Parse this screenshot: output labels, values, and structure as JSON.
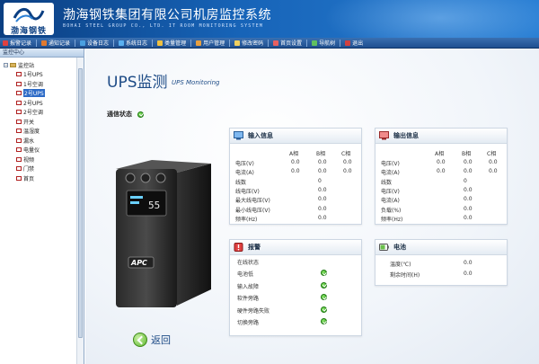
{
  "header": {
    "logo_text": "渤海钢铁",
    "title": "渤海钢铁集团有限公司机房监控系统",
    "subtitle": "BOHAI STEEL GROUP CO., LTD. IT ROOM MONITORING SYSTEM"
  },
  "toolbar": [
    {
      "label": "报警记录",
      "icon": "alarm-record-icon",
      "color": "#e04040"
    },
    {
      "label": "通知记录",
      "icon": "notice-record-icon",
      "color": "#e07a30"
    },
    {
      "label": "设备日志",
      "icon": "device-log-icon",
      "color": "#4aa0e0"
    },
    {
      "label": "系统日志",
      "icon": "system-log-icon",
      "color": "#5ab0f0"
    },
    {
      "label": "类量管理",
      "icon": "category-icon",
      "color": "#f0c040"
    },
    {
      "label": "用户管理",
      "icon": "user-icon",
      "color": "#e8a040"
    },
    {
      "label": "修改密码",
      "icon": "password-icon",
      "color": "#f0d060"
    },
    {
      "label": "首页设置",
      "icon": "home-settings-icon",
      "color": "#e86060"
    },
    {
      "label": "导航树",
      "icon": "nav-tree-icon",
      "color": "#60c060"
    },
    {
      "label": "退出",
      "icon": "exit-icon",
      "color": "#d04040"
    }
  ],
  "sidebar": {
    "header": "监控中心",
    "root": "监控站",
    "items": [
      "1号UPS",
      "1号空调",
      "2号UPS",
      "2号UPS",
      "2号空调",
      "开关",
      "温湿度",
      "漏水",
      "电量仪",
      "视频",
      "门禁",
      "首页"
    ],
    "selected_index": 2
  },
  "main": {
    "title": "UPS监测",
    "title_en": "UPS Monitoring",
    "comm_label": "通信状态",
    "comm_ok": true,
    "back_label": "返回"
  },
  "input_panel": {
    "title": "输入信息",
    "columns": [
      "A相",
      "B相",
      "C相"
    ],
    "rows": [
      {
        "label": "电压(V)",
        "values": [
          "0.0",
          "0.0",
          "0.0"
        ]
      },
      {
        "label": "电流(A)",
        "values": [
          "0.0",
          "0.0",
          "0.0"
        ]
      },
      {
        "label": "线数",
        "values": [
          "",
          "0",
          ""
        ]
      },
      {
        "label": "线电压(V)",
        "values": [
          "",
          "0.0",
          ""
        ]
      },
      {
        "label": "最大线电压(V)",
        "values": [
          "",
          "0.0",
          ""
        ]
      },
      {
        "label": "最小线电压(V)",
        "values": [
          "",
          "0.0",
          ""
        ]
      },
      {
        "label": "频率(Hz)",
        "values": [
          "",
          "0.0",
          ""
        ]
      }
    ]
  },
  "output_panel": {
    "title": "输出信息",
    "columns": [
      "A相",
      "B相",
      "C相"
    ],
    "rows": [
      {
        "label": "电压(V)",
        "values": [
          "0.0",
          "0.0",
          "0.0"
        ]
      },
      {
        "label": "电流(A)",
        "values": [
          "0.0",
          "0.0",
          "0.0"
        ]
      },
      {
        "label": "线数",
        "values": [
          "",
          "0",
          ""
        ]
      },
      {
        "label": "电压(V)",
        "values": [
          "",
          "0.0",
          ""
        ]
      },
      {
        "label": "电流(A)",
        "values": [
          "",
          "0.0",
          ""
        ]
      },
      {
        "label": "负载(%)",
        "values": [
          "",
          "0.0",
          ""
        ]
      },
      {
        "label": "频率(Hz)",
        "values": [
          "",
          "0.0",
          ""
        ]
      }
    ]
  },
  "alarm_panel": {
    "title": "报警",
    "rows": [
      {
        "label": "在线状态",
        "ok": false
      },
      {
        "label": "电池低",
        "ok": true
      },
      {
        "label": "输入故障",
        "ok": true
      },
      {
        "label": "软件旁路",
        "ok": true
      },
      {
        "label": "硬件旁路失败",
        "ok": true
      },
      {
        "label": "切换旁路",
        "ok": true
      }
    ]
  },
  "battery_panel": {
    "title": "电池",
    "rows": [
      {
        "label": "温度(℃)",
        "value": "0.0"
      },
      {
        "label": "剩余时间(H)",
        "value": "0.0"
      }
    ]
  },
  "device": {
    "display_text": "55",
    "brand": "APC"
  }
}
